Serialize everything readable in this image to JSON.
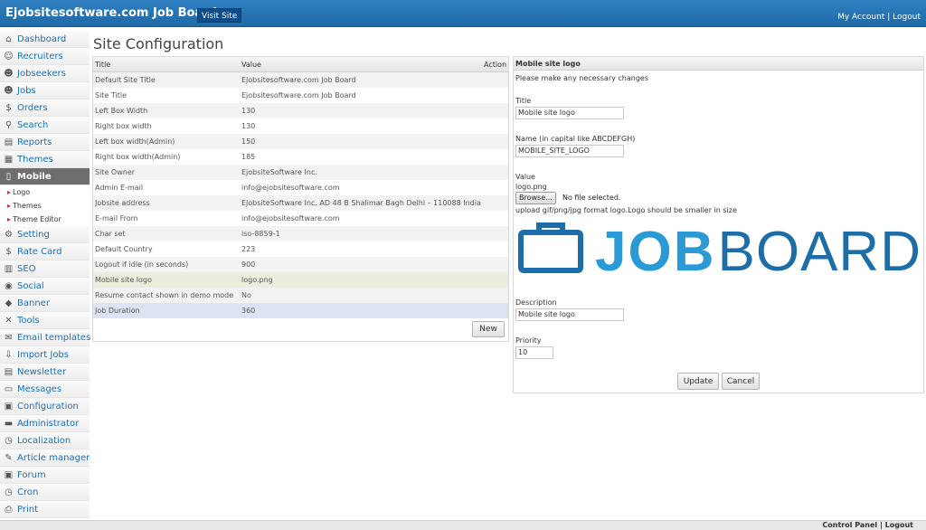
{
  "header": {
    "brand": "Ejobsitesoftware.com Job Board",
    "visit_site": "Visit Site",
    "my_account": "My Account",
    "separator": "|",
    "logout": "Logout"
  },
  "sidebar": {
    "items": [
      {
        "label": "Dashboard",
        "icon": "home-icon",
        "glyph": "⌂"
      },
      {
        "label": "Recruiters",
        "icon": "person-icon",
        "glyph": "☺"
      },
      {
        "label": "Jobseekers",
        "icon": "people-icon",
        "glyph": "☻"
      },
      {
        "label": "Jobs",
        "icon": "users-icon",
        "glyph": "☻"
      },
      {
        "label": "Orders",
        "icon": "money-icon",
        "glyph": "$"
      },
      {
        "label": "Search",
        "icon": "search-icon",
        "glyph": "⚲"
      },
      {
        "label": "Reports",
        "icon": "book-icon",
        "glyph": "▤"
      },
      {
        "label": "Themes",
        "icon": "grid-icon",
        "glyph": "▦"
      },
      {
        "label": "Mobile",
        "icon": "mobile-icon",
        "glyph": "▯"
      }
    ],
    "mobile_sub": [
      "Logo",
      "Themes",
      "Theme Editor"
    ],
    "items_after": [
      {
        "label": "Setting",
        "icon": "gear-icon",
        "glyph": "⚙"
      },
      {
        "label": "Rate Card",
        "icon": "dollar-icon",
        "glyph": "$"
      },
      {
        "label": "SEO",
        "icon": "chart-icon",
        "glyph": "▥"
      },
      {
        "label": "Social",
        "icon": "globe-icon",
        "glyph": "◉"
      },
      {
        "label": "Banner",
        "icon": "banner-icon",
        "glyph": "◆"
      },
      {
        "label": "Tools",
        "icon": "tools-icon",
        "glyph": "✕"
      },
      {
        "label": "Email templates",
        "icon": "email-icon",
        "glyph": "✉"
      },
      {
        "label": "Import Jobs",
        "icon": "import-icon",
        "glyph": "⇩"
      },
      {
        "label": "Newsletter",
        "icon": "newsletter-icon",
        "glyph": "▤"
      },
      {
        "label": "Messages",
        "icon": "messages-icon",
        "glyph": "▭"
      },
      {
        "label": "Configuration",
        "icon": "configuration-icon",
        "glyph": "▣"
      },
      {
        "label": "Administrator",
        "icon": "lock-icon",
        "glyph": "▬"
      },
      {
        "label": "Localization",
        "icon": "clock-icon",
        "glyph": "◷"
      },
      {
        "label": "Article manager",
        "icon": "article-icon",
        "glyph": "✎"
      },
      {
        "label": "Forum",
        "icon": "forum-icon",
        "glyph": "▣"
      },
      {
        "label": "Cron",
        "icon": "cron-icon",
        "glyph": "◷"
      },
      {
        "label": "Print",
        "icon": "print-icon",
        "glyph": "⎙"
      }
    ]
  },
  "page": {
    "title": "Site Configuration"
  },
  "grid": {
    "headers": {
      "title": "Title",
      "value": "Value",
      "action": "Action"
    },
    "rows": [
      {
        "title": "Default Site Title",
        "value": "Ejobsitesoftware.com Job Board"
      },
      {
        "title": "Site Title",
        "value": "Ejobsitesoftware.com Job Board"
      },
      {
        "title": "Left Box Width",
        "value": "130"
      },
      {
        "title": "Right box width",
        "value": "130"
      },
      {
        "title": "Left box width(Admin)",
        "value": "150"
      },
      {
        "title": "Right box width(Admin)",
        "value": "185"
      },
      {
        "title": "Site Owner",
        "value": "EjobsiteSoftware Inc."
      },
      {
        "title": "Admin E-mail",
        "value": "info@ejobsitesoftware.com"
      },
      {
        "title": "Jobsite address",
        "value": "EjobsiteSoftware Inc. AD 48 B Shalimar Bagh Delhi – 110088 India"
      },
      {
        "title": "E-mail From",
        "value": "info@ejobsitesoftware.com"
      },
      {
        "title": "Char set",
        "value": "iso-8859-1"
      },
      {
        "title": "Default Country",
        "value": "223"
      },
      {
        "title": "Logout if idle (in seconds)",
        "value": "900"
      },
      {
        "title": "Mobile site logo",
        "value": "logo.png"
      },
      {
        "title": "Resume contact shown in demo mode",
        "value": "No"
      },
      {
        "title": "Job Duration",
        "value": "360"
      }
    ],
    "selected_row": "Mobile site logo",
    "info_glyph": "i",
    "arrow_glyph": "▶",
    "new_button": "New"
  },
  "panel": {
    "heading": "Mobile site logo",
    "intro": "Please make any necessary changes",
    "title_label": "Title",
    "title_value": "Mobile site logo",
    "name_label": "Name (in capital like ABCDEFGH)",
    "name_value": "MOBILE_SITE_LOGO",
    "value_label": "Value",
    "value_text": "logo.png",
    "browse_button": "Browse...",
    "no_file": "No file selected.",
    "hint": "upload gif/png/jpg format logo.Logo should be smaller in size",
    "logo_text_job": "JOB",
    "logo_text_board": "BOARD",
    "logo_color_job": "#2a9ad6",
    "logo_color_board": "#1d6ea8",
    "description_label": "Description",
    "description_value": "Mobile site logo",
    "priority_label": "Priority",
    "priority_value": "10",
    "update_button": "Update",
    "cancel_button": "Cancel"
  },
  "footer": {
    "control_panel": "Control Panel",
    "separator": "|",
    "logout": "Logout"
  }
}
